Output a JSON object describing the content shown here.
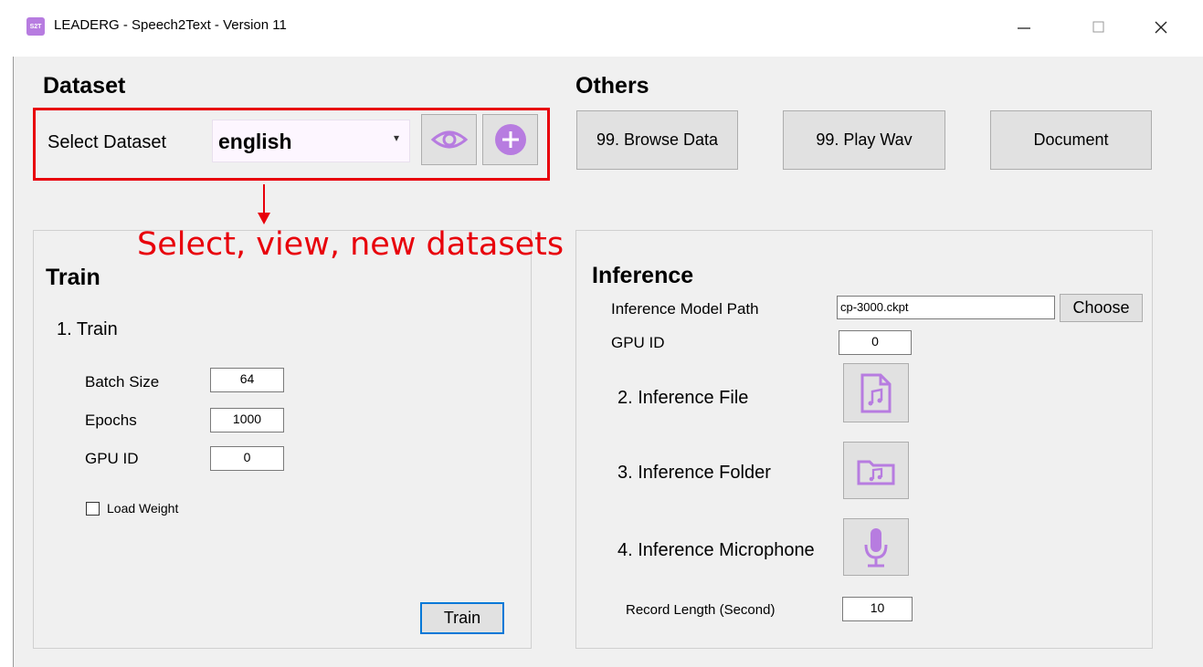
{
  "window": {
    "app_icon_text": "S2T",
    "title": "LEADERG - Speech2Text - Version 11"
  },
  "dataset": {
    "heading": "Dataset",
    "select_label": "Select Dataset",
    "selected_value": "english"
  },
  "others": {
    "heading": "Others",
    "browse_label": "99. Browse Data",
    "play_label": "99. Play Wav",
    "document_label": "Document"
  },
  "annotation": {
    "text": "Select, view, new datasets",
    "color": "#e8000b"
  },
  "train": {
    "heading": "Train",
    "step_label": "1. Train",
    "batch_size_label": "Batch Size",
    "batch_size_value": "64",
    "epochs_label": "Epochs",
    "epochs_value": "1000",
    "gpu_label": "GPU ID",
    "gpu_value": "0",
    "load_weight_label": "Load Weight",
    "train_button": "Train"
  },
  "inference": {
    "heading": "Inference",
    "model_path_label": "Inference Model Path",
    "model_path_value": "cp-3000.ckpt",
    "choose_button": "Choose",
    "gpu_label": "GPU ID",
    "gpu_value": "0",
    "file_label": "2. Inference File",
    "folder_label": "3. Inference Folder",
    "microphone_label": "4. Inference Microphone",
    "record_length_label": "Record Length (Second)",
    "record_length_value": "10"
  },
  "colors": {
    "accent_purple": "#b77ce0",
    "window_bg": "#f0f0f0"
  }
}
